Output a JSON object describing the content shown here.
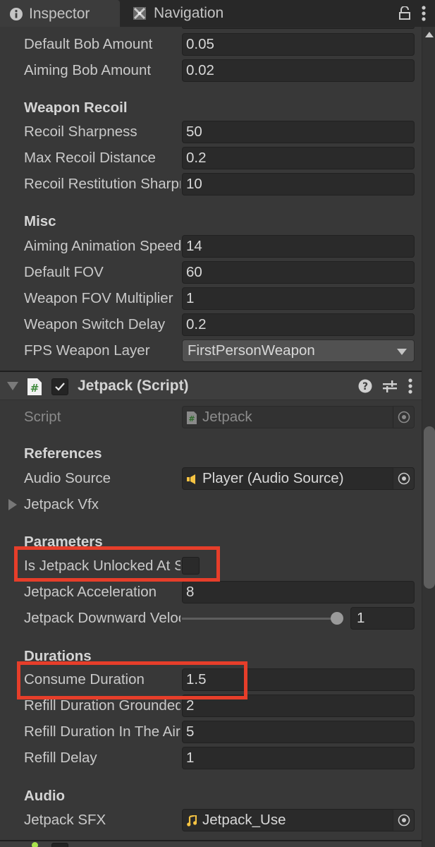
{
  "tabs": {
    "inspector": "Inspector",
    "navigation": "Navigation"
  },
  "icons": {
    "inspector_tab": "info-icon",
    "navigation_tab": "navigation-icon",
    "lock": "lock-open-icon",
    "menu": "kebab-menu-icon",
    "help": "help-icon",
    "presets": "presets-icon",
    "object_picker": "object-picker-icon",
    "audio_source": "audio-source-icon",
    "audio_clip": "audio-clip-icon",
    "script": "cs-script-icon"
  },
  "colors": {
    "highlight": "#e63e2a",
    "audio_icon": "#f5c342",
    "script_hash": "#3f8a3c",
    "next_component_dot": "#a9e34b"
  },
  "previous_component": {
    "fields": [
      {
        "label": "Default Bob Amount",
        "value": "0.05"
      },
      {
        "label": "Aiming Bob Amount",
        "value": "0.02"
      }
    ],
    "weapon_recoil": {
      "header": "Weapon Recoil",
      "fields": [
        {
          "label": "Recoil Sharpness",
          "value": "50"
        },
        {
          "label": "Max Recoil Distance",
          "value": "0.2"
        },
        {
          "label": "Recoil Restitution Sharpness",
          "value": "10"
        }
      ]
    },
    "misc": {
      "header": "Misc",
      "fields": [
        {
          "label": "Aiming Animation Speed",
          "value": "14"
        },
        {
          "label": "Default FOV",
          "value": "60"
        },
        {
          "label": "Weapon FOV Multiplier",
          "value": "1"
        },
        {
          "label": "Weapon Switch Delay",
          "value": "0.2"
        }
      ],
      "layer": {
        "label": "FPS Weapon Layer",
        "value": "FirstPersonWeapon"
      }
    }
  },
  "jetpack": {
    "title": "Jetpack (Script)",
    "enabled": true,
    "script": {
      "label": "Script",
      "value": "Jetpack"
    },
    "references": {
      "header": "References",
      "audio_source": {
        "label": "Audio Source",
        "value": "Player (Audio Source)"
      },
      "vfx": {
        "label": "Jetpack Vfx"
      }
    },
    "parameters": {
      "header": "Parameters",
      "unlocked": {
        "label": "Is Jetpack Unlocked At Start",
        "checked": false
      },
      "acceleration": {
        "label": "Jetpack Acceleration",
        "value": "8"
      },
      "downward": {
        "label": "Jetpack Downward Velocity Cancelling Factor",
        "value": "1",
        "slider_fraction": 1.0
      }
    },
    "durations": {
      "header": "Durations",
      "fields": [
        {
          "label": "Consume Duration",
          "value": "1.5"
        },
        {
          "label": "Refill Duration Grounded",
          "value": "2"
        },
        {
          "label": "Refill Duration In The Air",
          "value": "5"
        },
        {
          "label": "Refill Delay",
          "value": "1"
        }
      ]
    },
    "audio": {
      "header": "Audio",
      "sfx": {
        "label": "Jetpack SFX",
        "value": "Jetpack_Use"
      }
    }
  }
}
